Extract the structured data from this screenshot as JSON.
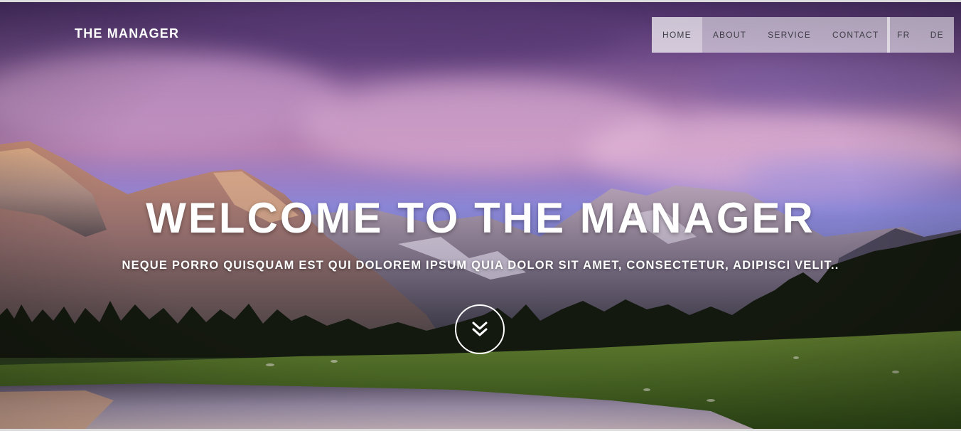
{
  "brand": {
    "title": "THE MANAGER"
  },
  "nav": {
    "items": [
      {
        "label": "HOME"
      },
      {
        "label": "ABOUT"
      },
      {
        "label": "SERVICE"
      },
      {
        "label": "CONTACT"
      }
    ],
    "languages": [
      {
        "label": "FR"
      },
      {
        "label": "DE"
      }
    ]
  },
  "hero": {
    "headline": "WELCOME TO THE MANAGER",
    "subheadline": "NEQUE PORRO QUISQUAM EST QUI DOLOREM IPSUM QUIA DOLOR SIT AMET, CONSECTETUR, ADIPISCI VELIT..",
    "scroll_icon": "double-chevron-down-icon"
  },
  "colors": {
    "nav_background": "#ffffff",
    "nav_text": "#3e3e46",
    "hero_text": "#ffffff"
  }
}
